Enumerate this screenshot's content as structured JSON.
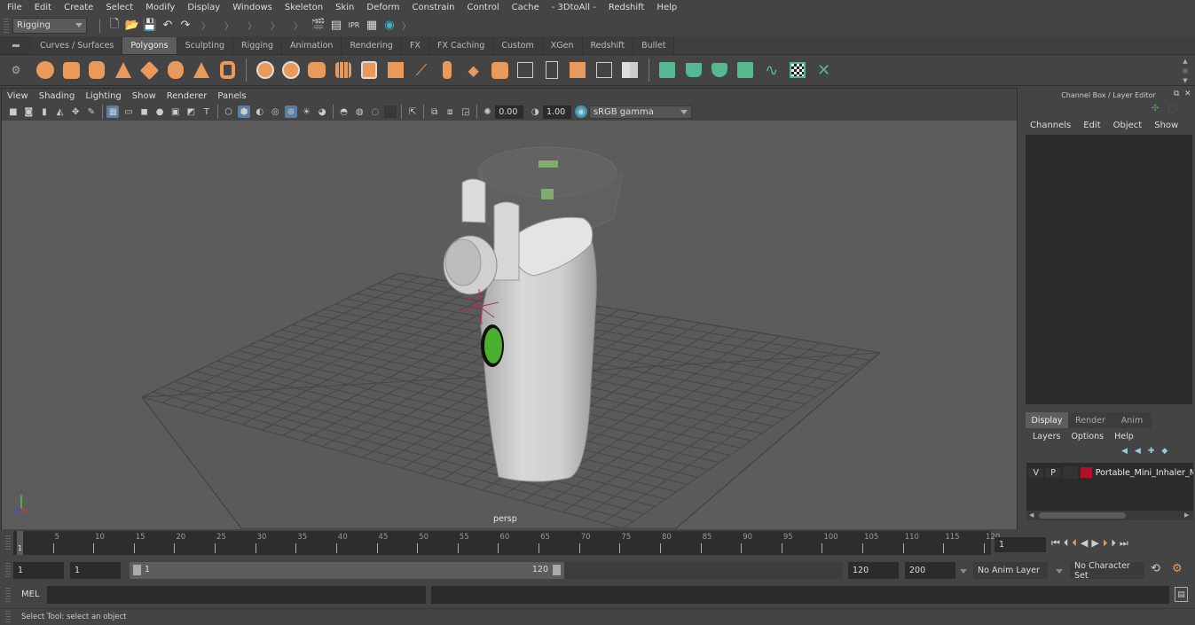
{
  "menubar": {
    "items": [
      "File",
      "Edit",
      "Create",
      "Select",
      "Modify",
      "Display",
      "Windows",
      "Skeleton",
      "Skin",
      "Deform",
      "Constrain",
      "Control",
      "Cache",
      "- 3DtoAll -",
      "Redshift",
      "Help"
    ]
  },
  "statusline": {
    "mode": "Rigging",
    "icons": [
      "new-scene-icon",
      "open-scene-icon",
      "save-scene-icon",
      "undo-icon",
      "redo-icon",
      "render-frame-icon",
      "ipr-render-icon",
      "render-settings-icon",
      "hypershade-icon"
    ]
  },
  "shelf": {
    "tabs": [
      "Curves / Surfaces",
      "Polygons",
      "Sculpting",
      "Rigging",
      "Animation",
      "Rendering",
      "FX",
      "FX Caching",
      "Custom",
      "XGen",
      "Redshift",
      "Bullet"
    ],
    "active_tab": "Polygons",
    "poly_icons": [
      "sphere",
      "cube",
      "cylinder",
      "cone",
      "torus-diamond",
      "platonic",
      "pyramid",
      "pipe"
    ],
    "tool_icons": [
      "combine",
      "separate",
      "mirror",
      "smooth",
      "bevel",
      "extrude",
      "bridge",
      "insert-edge-loop",
      "multi-cut",
      "target-weld",
      "quad-draw",
      "append",
      "booleans",
      "bounding",
      "unfold"
    ],
    "uv_icons": [
      "planar-uv",
      "cylindrical-uv",
      "spherical-uv",
      "auto-uv",
      "unfold-uv",
      "uv-editor",
      "cut-sew-uv"
    ]
  },
  "viewport": {
    "menu": [
      "View",
      "Shading",
      "Lighting",
      "Show",
      "Renderer",
      "Panels"
    ],
    "exposure": "0.00",
    "gamma": "1.00",
    "color_space": "sRGB gamma",
    "camera_label": "persp"
  },
  "channelbox": {
    "title": "Channel Box / Layer Editor",
    "menu": [
      "Channels",
      "Edit",
      "Object",
      "Show"
    ],
    "layer_tabs": [
      "Display",
      "Render",
      "Anim"
    ],
    "active_layer_tab": "Display",
    "layer_menu": [
      "Layers",
      "Options",
      "Help"
    ],
    "layers": [
      {
        "visible": "V",
        "playback": "P",
        "color": "#b0102a",
        "name": "Portable_Mini_Inhaler_M"
      }
    ]
  },
  "timeline": {
    "ticks": [
      "5",
      "10",
      "15",
      "20",
      "25",
      "30",
      "35",
      "40",
      "45",
      "50",
      "55",
      "60",
      "65",
      "70",
      "75",
      "80",
      "85",
      "90",
      "95",
      "100",
      "105",
      "110",
      "115",
      "120"
    ],
    "current_frame_marker": "1",
    "current_frame": "1"
  },
  "range": {
    "start": "1",
    "playback_start": "1",
    "slider_start": "1",
    "slider_end": "120",
    "playback_end": "120",
    "end": "200",
    "anim_layer": "No Anim Layer",
    "character_set": "No Character Set"
  },
  "command": {
    "label": "MEL",
    "input": "",
    "result": ""
  },
  "help_line": "Select Tool: select an object"
}
